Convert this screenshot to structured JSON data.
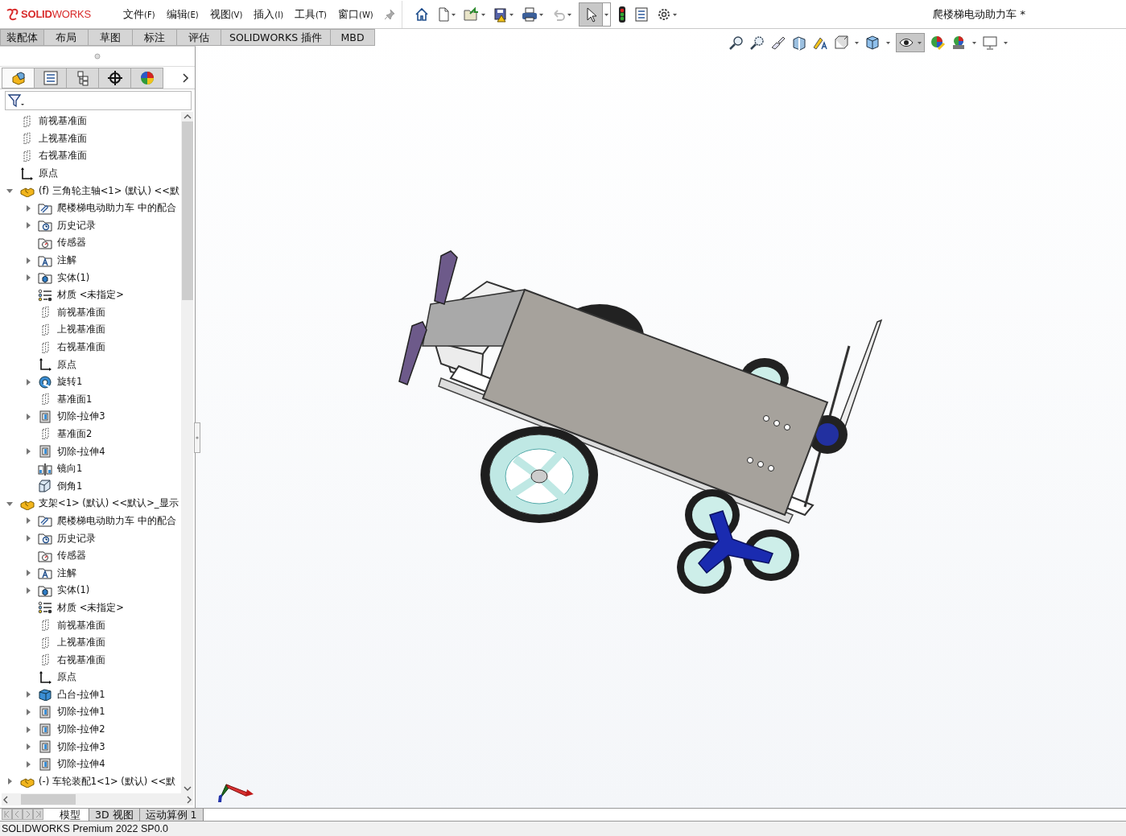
{
  "top_bar": {
    "logo": "**SOLID**WORKS",
    "menus": [
      {
        "label": "文件",
        "key": "(F)"
      },
      {
        "label": "编辑",
        "key": "(E)"
      },
      {
        "label": "视图",
        "key": "(V)"
      },
      {
        "label": "插入",
        "key": "(I)"
      },
      {
        "label": "工具",
        "key": "(T)"
      },
      {
        "label": "窗口",
        "key": "(W)"
      }
    ],
    "document_title": "爬楼梯电动助力车 *"
  },
  "command_tabs": [
    {
      "label": "装配体",
      "selected": true
    },
    {
      "label": "布局",
      "selected": false
    },
    {
      "label": "草图",
      "selected": false
    },
    {
      "label": "标注",
      "selected": false
    },
    {
      "label": "评估",
      "selected": false
    },
    {
      "label": "SOLIDWORKS 插件",
      "selected": false
    },
    {
      "label": "MBD",
      "selected": false
    }
  ],
  "panel_tabs": [
    {
      "kind": "feature",
      "selected": true
    },
    {
      "kind": "property",
      "selected": false
    },
    {
      "kind": "config",
      "selected": false
    },
    {
      "kind": "dimxpert",
      "selected": false
    },
    {
      "kind": "display",
      "selected": false
    }
  ],
  "tree": [
    {
      "label": "前视基准面",
      "kind": "plane",
      "expandable": false
    },
    {
      "label": "上视基准面",
      "kind": "plane",
      "expandable": false
    },
    {
      "label": "右视基准面",
      "kind": "plane",
      "expandable": false
    },
    {
      "label": "原点",
      "kind": "origin",
      "expandable": false
    },
    {
      "label": "(f) 三角轮主轴<1> (默认) <<默",
      "kind": "part",
      "expandable": true,
      "expanded": true,
      "children": [
        {
          "label": "爬楼梯电动助力车 中的配合",
          "kind": "mates",
          "expandable": true,
          "expanded": false
        },
        {
          "label": "历史记录",
          "kind": "history",
          "expandable": true,
          "expanded": false
        },
        {
          "label": "传感器",
          "kind": "sensor",
          "expandable": false
        },
        {
          "label": "注解",
          "kind": "annotation",
          "expandable": true,
          "expanded": false
        },
        {
          "label": "实体(1)",
          "kind": "solid",
          "expandable": true,
          "expanded": false
        },
        {
          "label": "材质 <未指定>",
          "kind": "material",
          "expandable": false
        },
        {
          "label": "前视基准面",
          "kind": "plane",
          "expandable": false
        },
        {
          "label": "上视基准面",
          "kind": "plane",
          "expandable": false
        },
        {
          "label": "右视基准面",
          "kind": "plane",
          "expandable": false
        },
        {
          "label": "原点",
          "kind": "origin",
          "expandable": false
        },
        {
          "label": "旋转1",
          "kind": "revolve",
          "expandable": true,
          "expanded": false
        },
        {
          "label": "基准面1",
          "kind": "plane",
          "expandable": false
        },
        {
          "label": "切除-拉伸3",
          "kind": "cut",
          "expandable": true,
          "expanded": false
        },
        {
          "label": "基准面2",
          "kind": "plane",
          "expandable": false
        },
        {
          "label": "切除-拉伸4",
          "kind": "cut",
          "expandable": true,
          "expanded": false
        },
        {
          "label": "镜向1",
          "kind": "mirror",
          "expandable": false
        },
        {
          "label": "倒角1",
          "kind": "chamfer",
          "expandable": false
        }
      ]
    },
    {
      "label": "支架<1> (默认) <<默认>_显示",
      "kind": "part",
      "expandable": true,
      "expanded": true,
      "children": [
        {
          "label": "爬楼梯电动助力车 中的配合",
          "kind": "mates",
          "expandable": true,
          "expanded": false
        },
        {
          "label": "历史记录",
          "kind": "history",
          "expandable": true,
          "expanded": false
        },
        {
          "label": "传感器",
          "kind": "sensor",
          "expandable": false
        },
        {
          "label": "注解",
          "kind": "annotation",
          "expandable": true,
          "expanded": false
        },
        {
          "label": "实体(1)",
          "kind": "solid",
          "expandable": true,
          "expanded": false
        },
        {
          "label": "材质 <未指定>",
          "kind": "material",
          "expandable": false
        },
        {
          "label": "前视基准面",
          "kind": "plane",
          "expandable": false
        },
        {
          "label": "上视基准面",
          "kind": "plane",
          "expandable": false
        },
        {
          "label": "右视基准面",
          "kind": "plane",
          "expandable": false
        },
        {
          "label": "原点",
          "kind": "origin",
          "expandable": false
        },
        {
          "label": "凸台-拉伸1",
          "kind": "boss",
          "expandable": true,
          "expanded": false
        },
        {
          "label": "切除-拉伸1",
          "kind": "cut",
          "expandable": true,
          "expanded": false
        },
        {
          "label": "切除-拉伸2",
          "kind": "cut",
          "expandable": true,
          "expanded": false
        },
        {
          "label": "切除-拉伸3",
          "kind": "cut",
          "expandable": true,
          "expanded": false
        },
        {
          "label": "切除-拉伸4",
          "kind": "cut",
          "expandable": true,
          "expanded": false
        }
      ]
    },
    {
      "label": "(-) 车轮装配1<1> (默认) <<默",
      "kind": "part",
      "expandable": true,
      "expanded": false
    }
  ],
  "bottom_tabs": [
    {
      "label": "模型",
      "selected": true
    },
    {
      "label": "3D 视图",
      "selected": false
    },
    {
      "label": "运动算例 1",
      "selected": false
    }
  ],
  "status_bar": {
    "text": "SOLIDWORKS Premium 2022 SP0.0"
  }
}
